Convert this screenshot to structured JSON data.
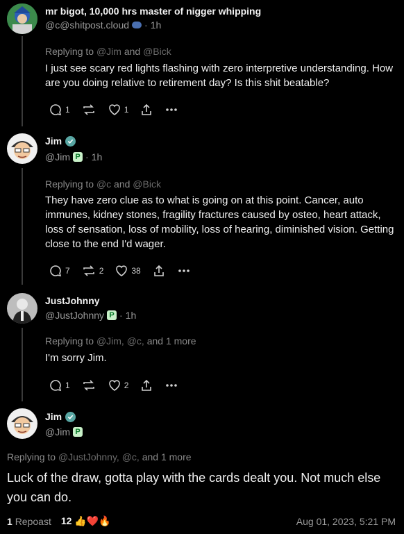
{
  "posts": [
    {
      "name": "mr bigot, 10,000 hrs master of nigger whipping",
      "handle": "@c@shitpost.cloud",
      "time": "1h",
      "replying_prefix": "Replying to",
      "replying_to": [
        "@Jim",
        "@Bick"
      ],
      "replying_joiner": "and",
      "text": "I just see scary red lights flashing with zero interpretive understanding. How are you doing relative to retirement day? Is this shit beatable?",
      "replies": "1",
      "reposts": "",
      "likes": "1"
    },
    {
      "name": "Jim",
      "handle": "@Jim",
      "time": "1h",
      "replying_prefix": "Replying to",
      "replying_to": [
        "@c",
        "@Bick"
      ],
      "replying_joiner": "and",
      "text": "They have zero clue as to what is going on at this point.  Cancer, auto immunes, kidney stones, fragility fractures caused by osteo, heart attack, loss of sensation, loss of mobility, loss of hearing, diminished vision.  Getting close to the end I'd wager.",
      "replies": "7",
      "reposts": "2",
      "likes": "38"
    },
    {
      "name": "JustJohnny",
      "handle": "@JustJohnny",
      "time": "1h",
      "replying_prefix": "Replying to",
      "replying_to": [
        "@Jim,",
        "@c,"
      ],
      "replying_more": "and 1 more",
      "text": "I'm sorry Jim.",
      "replies": "1",
      "reposts": "",
      "likes": "2"
    }
  ],
  "main_post": {
    "name": "Jim",
    "handle": "@Jim",
    "replying_prefix": "Replying to",
    "replying_to": [
      "@JustJohnny,",
      "@c,"
    ],
    "replying_more": "and 1 more",
    "text": "Luck of the draw, gotta play with the cards dealt you.  Not much else you can do.",
    "repost_count": "1",
    "repost_label": "Repoast",
    "reaction_count": "12",
    "reactions": "👍❤️🔥",
    "timestamp": "Aug 01, 2023, 5:21 PM"
  },
  "colors": {
    "background": "#000000",
    "muted": "#9a9a9a",
    "verified": "#58a6a3"
  }
}
